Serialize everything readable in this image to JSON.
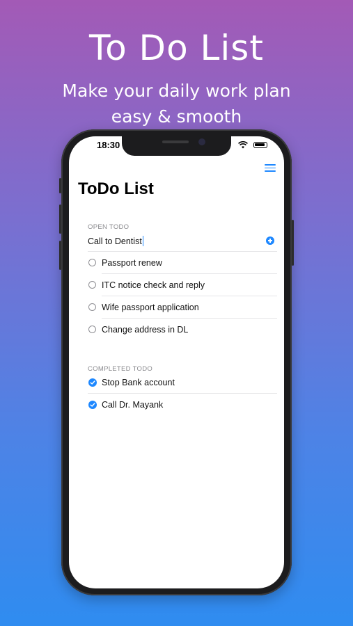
{
  "promo": {
    "title": "To Do List",
    "subtitle_line1": "Make your daily work plan",
    "subtitle_line2": "easy & smooth"
  },
  "status_bar": {
    "time": "18:30"
  },
  "app": {
    "title": "ToDo List",
    "accent_color": "#1e88ff",
    "open_section": {
      "header": "OPEN TODO",
      "input_value": "Call to Dentist",
      "items": [
        {
          "label": "Passport renew",
          "done": false
        },
        {
          "label": "ITC notice check and reply",
          "done": false
        },
        {
          "label": "Wife passport application",
          "done": false
        },
        {
          "label": "Change address in DL",
          "done": false
        }
      ]
    },
    "completed_section": {
      "header": "COMPLETED TODO",
      "items": [
        {
          "label": "Stop Bank account",
          "done": true
        },
        {
          "label": "Call Dr. Mayank",
          "done": true
        }
      ]
    }
  },
  "icons": {
    "menu": "hamburger-menu-icon",
    "add": "plus-circle-icon",
    "unchecked": "radio-empty-icon",
    "checked": "check-circle-icon",
    "wifi": "wifi-icon",
    "battery": "battery-icon",
    "signal": "signal-icon"
  }
}
